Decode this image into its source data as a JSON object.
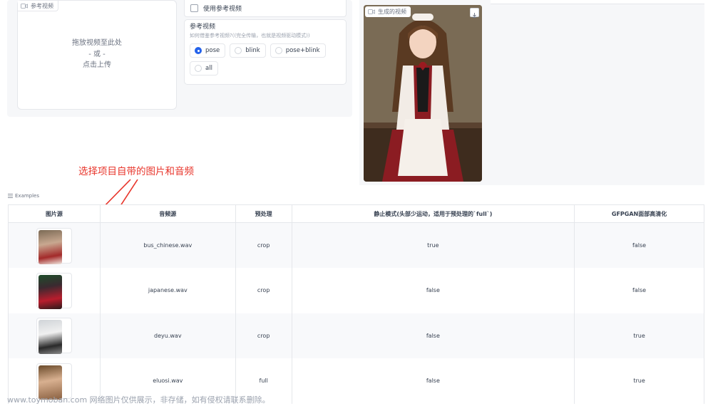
{
  "reference_video_upload": {
    "tag_label": "参考视频",
    "drop_text": "拖放视频至此处",
    "or_text": "- 或 -",
    "click_text": "点击上传"
  },
  "options": {
    "use_reference_checkbox": "使用参考视频",
    "reference_title": "参考视频",
    "reference_hint": "如何借鉴参考视频?((完全传输，也就是视频驱动模式))",
    "radio_options": [
      {
        "label": "pose",
        "selected": true
      },
      {
        "label": "blink",
        "selected": false
      },
      {
        "label": "pose+blink",
        "selected": false
      },
      {
        "label": "all",
        "selected": false
      }
    ]
  },
  "output_video": {
    "tag_label": "生成的视频",
    "download_icon": "download-icon"
  },
  "annotation": {
    "text": "选择项目自带的图片和音频",
    "color": "#e8352b"
  },
  "examples": {
    "label": "Examples",
    "headers": [
      "图片源",
      "音频源",
      "预处理",
      "静止模式(头部少运动，适用于预处理的`full`)",
      "GFPGAN面部高清化"
    ],
    "rows": [
      {
        "audio": "bus_chinese.wav",
        "preprocess": "crop",
        "still": "true",
        "gfpgan": "false"
      },
      {
        "audio": "japanese.wav",
        "preprocess": "crop",
        "still": "false",
        "gfpgan": "false"
      },
      {
        "audio": "deyu.wav",
        "preprocess": "crop",
        "still": "false",
        "gfpgan": "true"
      },
      {
        "audio": "eluosi.wav",
        "preprocess": "full",
        "still": "false",
        "gfpgan": "true"
      }
    ]
  },
  "watermark": "www.toymoban.com 网络图片仅供展示，非存储，如有侵权请联系删除。"
}
